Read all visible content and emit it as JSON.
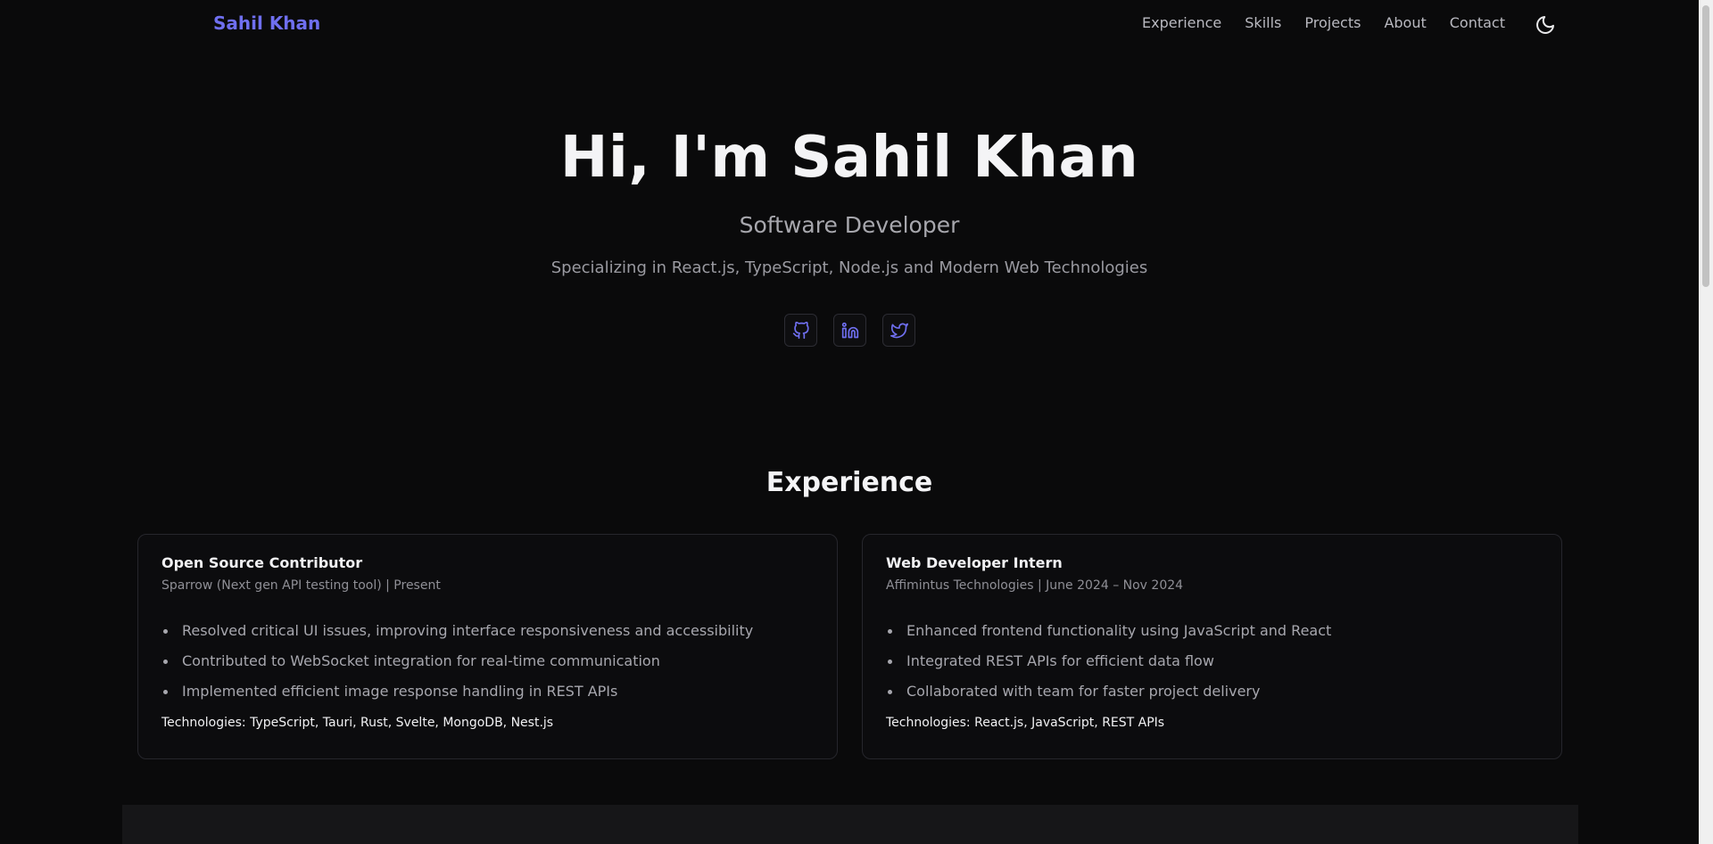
{
  "brand": "Sahil Khan",
  "nav": [
    "Experience",
    "Skills",
    "Projects",
    "About",
    "Contact"
  ],
  "hero": {
    "title": "Hi, I'm Sahil Khan",
    "role": "Software Developer",
    "tagline": "Specializing in React.js, TypeScript, Node.js and Modern Web Technologies"
  },
  "socials": [
    {
      "name": "github-icon"
    },
    {
      "name": "linkedin-icon"
    },
    {
      "name": "twitter-icon"
    }
  ],
  "experience": {
    "title": "Experience",
    "cards": [
      {
        "title": "Open Source Contributor",
        "sub": "Sparrow (Next gen API testing tool) | Present",
        "points": [
          "Resolved critical UI issues, improving interface responsiveness and accessibility",
          "Contributed to WebSocket integration for real-time communication",
          "Implemented efficient image response handling in REST APIs"
        ],
        "tech": "Technologies: TypeScript, Tauri, Rust, Svelte, MongoDB, Nest.js"
      },
      {
        "title": "Web Developer Intern",
        "sub": "Affimintus Technologies | June 2024 – Nov 2024",
        "points": [
          "Enhanced frontend functionality using JavaScript and React",
          "Integrated REST APIs for efficient data flow",
          "Collaborated with team for faster project delivery"
        ],
        "tech": "Technologies: React.js, JavaScript, REST APIs"
      }
    ]
  },
  "colors": {
    "accent": "#6f6ff0",
    "background": "#0a0a0b"
  }
}
